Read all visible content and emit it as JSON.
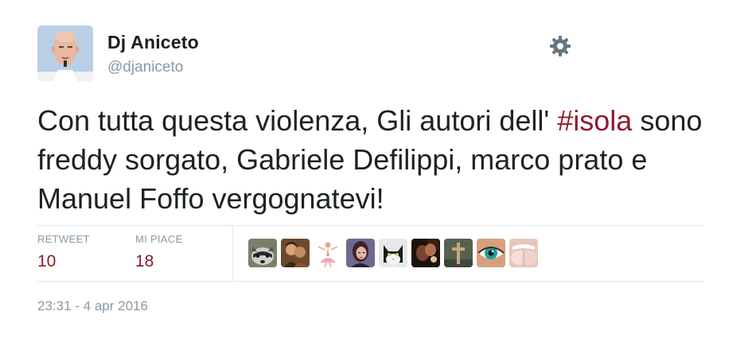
{
  "user": {
    "display_name": "Dj Aniceto",
    "handle": "@djaniceto"
  },
  "tweet": {
    "text_before_hashtag": "Con tutta questa violenza, Gli autori dell' ",
    "hashtag": "#isola",
    "text_after_hashtag": " sono freddy sorgato, Gabriele Defilippi, marco prato e Manuel Foffo vergognatevi!"
  },
  "stats": {
    "retweets": {
      "label": "RETWEET",
      "value": "10"
    },
    "likes": {
      "label": "MI PIACE",
      "value": "18"
    }
  },
  "likers": [
    {
      "icon": "raccoon-avatar"
    },
    {
      "icon": "couple-avatar"
    },
    {
      "icon": "dancer-avatar"
    },
    {
      "icon": "woman-avatar"
    },
    {
      "icon": "cat-avatar"
    },
    {
      "icon": "dark-portrait-avatar"
    },
    {
      "icon": "cross-avatar"
    },
    {
      "icon": "eye-avatar"
    },
    {
      "icon": "lips-avatar"
    }
  ],
  "timestamp": "23:31 - 4 apr 2016",
  "colors": {
    "accent": "#8d1b2b",
    "muted": "#8899a6",
    "divider": "#e1e8ed",
    "text": "#1c2125"
  }
}
